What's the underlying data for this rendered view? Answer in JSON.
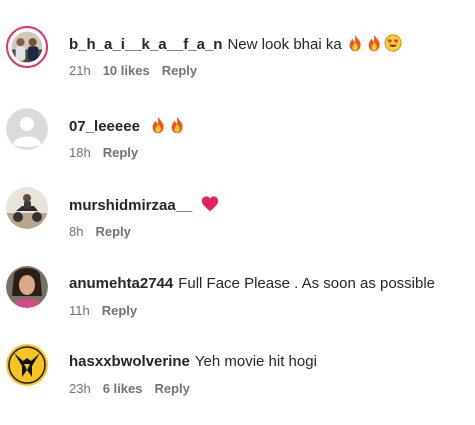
{
  "comments": [
    {
      "username": "b_h_a_i__k_a__f_a_n",
      "text": "New look bhai ka",
      "emojis": [
        "fire-emoji",
        "fire-emoji",
        "heart-eyes-emoji"
      ],
      "time": "21h",
      "likes": "10 likes",
      "reply": "Reply",
      "avatar": "group-photo-avatar"
    },
    {
      "username": "07_leeeee",
      "text": "",
      "emojis": [
        "fire-emoji",
        "fire-emoji"
      ],
      "time": "18h",
      "likes": "",
      "reply": "Reply",
      "avatar": "default-user-avatar"
    },
    {
      "username": "murshidmirzaa__",
      "text": "",
      "emojis": [
        "red-heart-emoji"
      ],
      "time": "8h",
      "likes": "",
      "reply": "Reply",
      "avatar": "motorbike-photo-avatar"
    },
    {
      "username": "anumehta2744",
      "text": "Full Face Please . As soon as possible",
      "emojis": [],
      "time": "11h",
      "likes": "",
      "reply": "Reply",
      "avatar": "girl-photo-avatar"
    },
    {
      "username": "hasxxbwolverine",
      "text": "Yeh movie hit hogi",
      "emojis": [],
      "time": "23h",
      "likes": "6 likes",
      "reply": "Reply",
      "avatar": "wolverine-logo-avatar"
    }
  ]
}
